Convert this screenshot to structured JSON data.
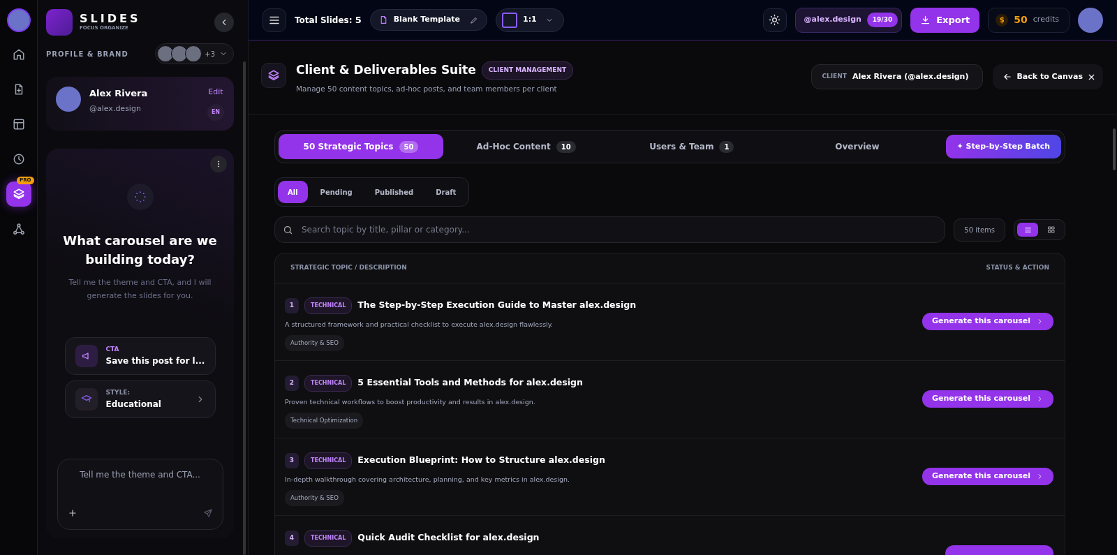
{
  "rail": {
    "items": [
      {
        "selected": false
      },
      {
        "selected": false
      },
      {
        "selected": false
      },
      {
        "selected": false
      },
      {
        "selected": true,
        "badge": "PRO"
      },
      {
        "selected": false
      }
    ]
  },
  "sidebar": {
    "brand": "SLIDES",
    "tagline": "FOCUS ORGANIZE",
    "section_label": "PROFILE & BRAND",
    "more_count": "+3",
    "profile": {
      "name": "Alex Rivera",
      "handle": "@alex.design",
      "edit": "Edit",
      "language": "EN"
    },
    "assistant": {
      "heading": "What carousel are we building today?",
      "subtitle": "Tell me the theme and CTA, and I will generate the slides for you.",
      "options": [
        {
          "kind": "cta",
          "label": "CTA",
          "value": "Save this post for l..."
        },
        {
          "kind": "style",
          "label": "STYLE:",
          "value": "Educational"
        }
      ],
      "input": {
        "placeholder": "Tell me the theme and CTA..."
      }
    }
  },
  "topbar": {
    "total_label": "Total Slides:",
    "total_value": "5",
    "template": "Blank Template",
    "ratio": "1:1",
    "handle": "@alex.design",
    "usage": "19/30",
    "export": "Export",
    "currency": "$",
    "credits_value": "50",
    "credits_label": "credits"
  },
  "header": {
    "title": "Client & Deliverables Suite",
    "badge": "CLIENT MANAGEMENT",
    "description": "Manage 50 content topics, ad-hoc posts, and team members per client",
    "client_label": "CLIENT",
    "client_value": "Alex Rivera (@alex.design)",
    "back": "Back to Canvas"
  },
  "tabs": [
    {
      "label": "50 Strategic Topics",
      "count": "50",
      "selected": true
    },
    {
      "label": "Ad-Hoc Content",
      "count": "10",
      "selected": false
    },
    {
      "label": "Users & Team",
      "count": "1",
      "selected": false
    },
    {
      "label": "Overview",
      "selected": false
    }
  ],
  "batch_button": "✦ Step-by-Step Batch",
  "filters": [
    {
      "label": "All",
      "selected": true
    },
    {
      "label": "Pending",
      "selected": false
    },
    {
      "label": "Published",
      "selected": false
    },
    {
      "label": "Draft",
      "selected": false
    }
  ],
  "search": {
    "placeholder": "Search topic by title, pillar or category..."
  },
  "items_count": "50 items",
  "views": [
    {
      "selected": true
    },
    {
      "selected": false
    }
  ],
  "table": {
    "columns": [
      "STRATEGIC TOPIC / DESCRIPTION",
      "STATUS & ACTION"
    ],
    "rows": [
      {
        "number": "1",
        "tag": "TECHNICAL",
        "title": "The Step-by-Step Execution Guide to Master alex.design",
        "description": "A structured framework and practical checklist to execute alex.design flawlessly.",
        "category": "Authority & SEO",
        "action": "Generate this carousel"
      },
      {
        "number": "2",
        "tag": "TECHNICAL",
        "title": "5 Essential Tools and Methods for alex.design",
        "description": "Proven technical workflows to boost productivity and results in alex.design.",
        "category": "Technical Optimization",
        "action": "Generate this carousel"
      },
      {
        "number": "3",
        "tag": "TECHNICAL",
        "title": "Execution Blueprint: How to Structure alex.design",
        "description": "In-depth walkthrough covering architecture, planning, and key metrics in alex.design.",
        "category": "Authority & SEO",
        "action": "Generate this carousel"
      },
      {
        "number": "4",
        "tag": "TECHNICAL",
        "title": "Quick Audit Checklist for alex.design"
      }
    ]
  }
}
